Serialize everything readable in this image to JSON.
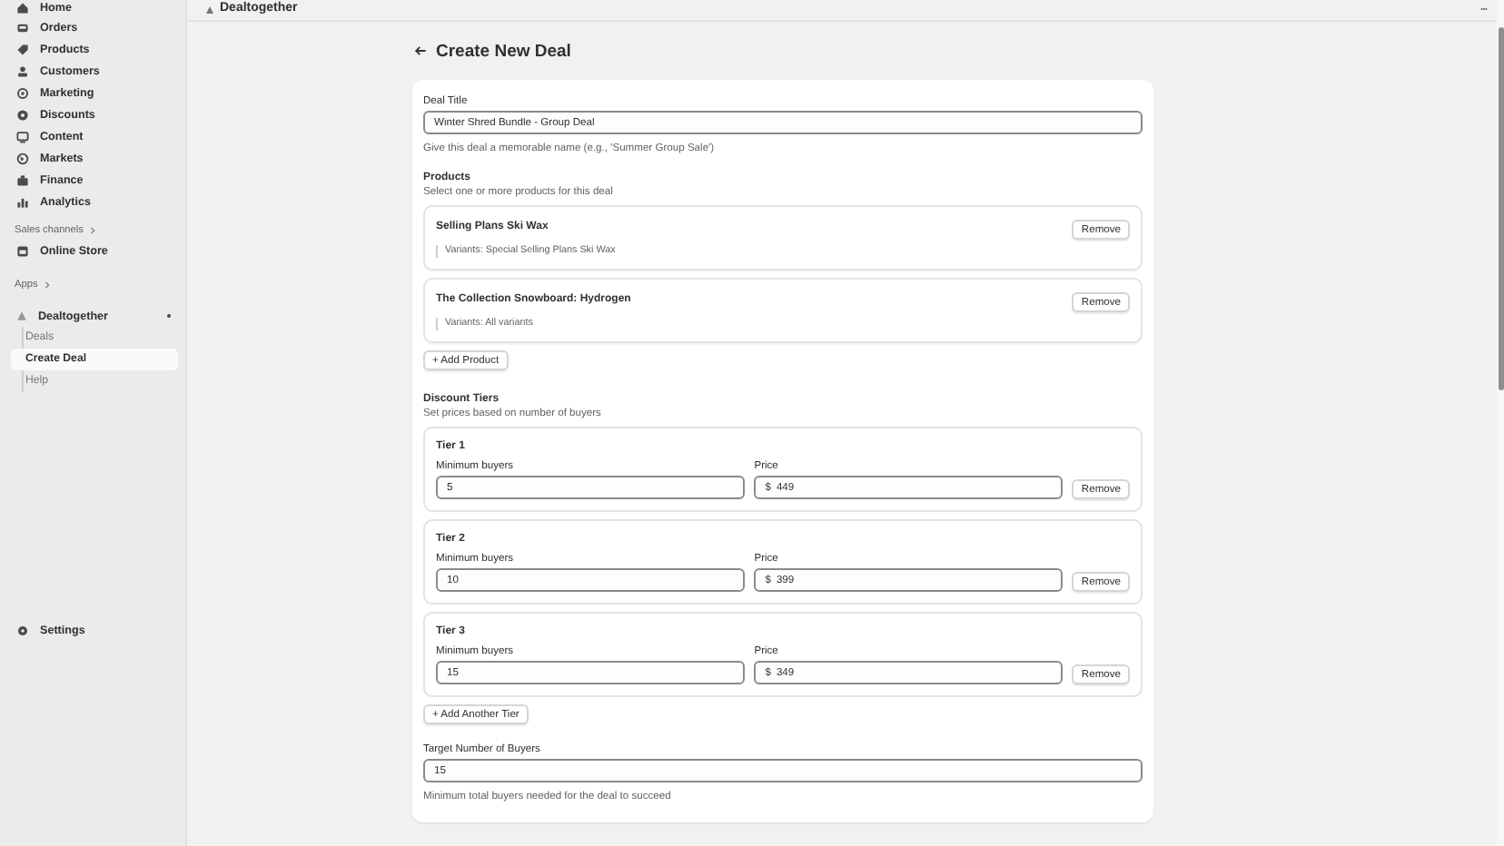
{
  "app_header": {
    "title": "Dealtogether"
  },
  "sidebar": {
    "items": [
      {
        "label": "Home",
        "selected": false
      },
      {
        "label": "Orders",
        "selected": false
      },
      {
        "label": "Products",
        "selected": false
      },
      {
        "label": "Customers",
        "selected": false
      },
      {
        "label": "Marketing",
        "selected": false
      },
      {
        "label": "Discounts",
        "selected": false
      },
      {
        "label": "Content",
        "selected": false
      },
      {
        "label": "Markets",
        "selected": false
      },
      {
        "label": "Finance",
        "selected": false
      },
      {
        "label": "Analytics",
        "selected": false
      }
    ],
    "sales_channels": {
      "heading": "Sales channels",
      "items": [
        {
          "label": "Online Store",
          "selected": false
        }
      ]
    },
    "apps": {
      "heading": "Apps",
      "app": {
        "label": "Dealtogether",
        "expanded": true,
        "children": [
          {
            "label": "Deals",
            "selected": false
          },
          {
            "label": "Create Deal",
            "selected": true
          },
          {
            "label": "Help",
            "selected": false
          }
        ]
      }
    },
    "settings": {
      "label": "Settings"
    }
  },
  "page": {
    "title": "Create New Deal",
    "deal_title": {
      "label": "Deal Title",
      "value": "Winter Shred Bundle - Group Deal",
      "help": "Give this deal a memorable name (e.g., 'Summer Group Sale')"
    },
    "products": {
      "heading": "Products",
      "subheading": "Select one or more products for this deal",
      "items": [
        {
          "name": "Selling Plans Ski Wax",
          "variants": "Variants: Special Selling Plans Ski Wax",
          "button": "Remove"
        },
        {
          "name": "The Collection Snowboard: Hydrogen",
          "variants": "Variants: All variants",
          "button": "Remove"
        }
      ],
      "add_button": "+ Add Product"
    },
    "tiers": {
      "heading": "Discount Tiers",
      "subheading": "Set prices based on number of buyers",
      "items": [
        {
          "title": "Tier 1",
          "min_label": "Minimum buyers",
          "min_value": "5",
          "price_label": "Price",
          "currency": "$",
          "price_value": "449",
          "button": "Remove"
        },
        {
          "title": "Tier 2",
          "min_label": "Minimum buyers",
          "min_value": "10",
          "price_label": "Price",
          "currency": "$",
          "price_value": "399",
          "button": "Remove"
        },
        {
          "title": "Tier 3",
          "min_label": "Minimum buyers",
          "min_value": "15",
          "price_label": "Price",
          "currency": "$",
          "price_value": "349",
          "button": "Remove"
        }
      ],
      "add_button": "+ Add Another Tier"
    },
    "target": {
      "label": "Target Number of Buyers",
      "value": "15",
      "help": "Minimum total buyers needed for the deal to succeed"
    }
  }
}
